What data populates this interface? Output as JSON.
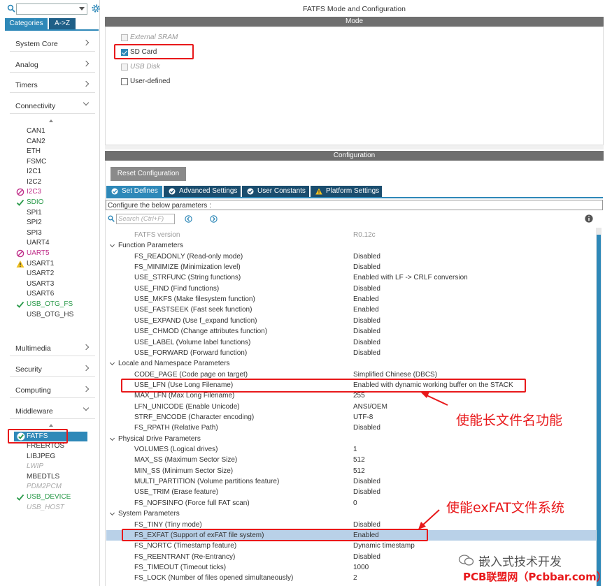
{
  "left": {
    "tabs": [
      "Categories",
      "A->Z"
    ],
    "categories": [
      "System Core",
      "Analog",
      "Timers",
      "Connectivity"
    ],
    "connectivity_items": [
      "CAN1",
      "CAN2",
      "ETH",
      "FSMC",
      "I2C1",
      "I2C2",
      "I2C3",
      "SDIO",
      "SPI1",
      "SPI2",
      "SPI3",
      "UART4",
      "UART5",
      "USART1",
      "USART2",
      "USART3",
      "USART6",
      "USB_OTG_FS",
      "USB_OTG_HS"
    ],
    "categories2": [
      "Multimedia",
      "Security",
      "Computing",
      "Middleware"
    ],
    "middleware_items": [
      "FATFS",
      "FREERTOS",
      "LIBJPEG",
      "LWIP",
      "MBEDTLS",
      "PDM2PCM",
      "USB_DEVICE",
      "USB_HOST"
    ]
  },
  "header": {
    "title": "FATFS Mode and Configuration",
    "mode_bar": "Mode",
    "config_bar": "Configuration"
  },
  "mode": {
    "options": [
      {
        "label": "External SRAM",
        "checked": false,
        "disabled": true
      },
      {
        "label": "SD Card",
        "checked": true,
        "disabled": false
      },
      {
        "label": "USB Disk",
        "checked": false,
        "disabled": true
      },
      {
        "label": "User-defined",
        "checked": false,
        "disabled": false
      }
    ]
  },
  "config": {
    "reset_label": "Reset Configuration",
    "tabs": [
      "Set Defines",
      "Advanced Settings",
      "User Constants",
      "Platform Settings"
    ],
    "description": "Configure the below parameters :",
    "search_placeholder": "Search (Ctrl+F)",
    "rows": [
      {
        "kind": "param",
        "dim": true,
        "name": "FATFS version",
        "value": "R0.12c"
      },
      {
        "kind": "group",
        "name": "Function Parameters"
      },
      {
        "kind": "param",
        "name": "FS_READONLY (Read-only mode)",
        "value": "Disabled"
      },
      {
        "kind": "param",
        "name": "FS_MINIMIZE (Minimization level)",
        "value": "Disabled"
      },
      {
        "kind": "param",
        "name": "USE_STRFUNC (String functions)",
        "value": "Enabled with LF -> CRLF conversion"
      },
      {
        "kind": "param",
        "name": "USE_FIND (Find functions)",
        "value": "Disabled"
      },
      {
        "kind": "param",
        "name": "USE_MKFS (Make filesystem function)",
        "value": "Enabled"
      },
      {
        "kind": "param",
        "name": "USE_FASTSEEK (Fast seek function)",
        "value": "Enabled"
      },
      {
        "kind": "param",
        "name": "USE_EXPAND (Use f_expand function)",
        "value": "Disabled"
      },
      {
        "kind": "param",
        "name": "USE_CHMOD (Change attributes function)",
        "value": "Disabled"
      },
      {
        "kind": "param",
        "name": "USE_LABEL (Volume label functions)",
        "value": "Disabled"
      },
      {
        "kind": "param",
        "name": "USE_FORWARD (Forward function)",
        "value": "Disabled"
      },
      {
        "kind": "group",
        "name": "Locale and Namespace Parameters"
      },
      {
        "kind": "param",
        "name": "CODE_PAGE (Code page on target)",
        "value": "Simplified Chinese (DBCS)"
      },
      {
        "kind": "param",
        "name": "USE_LFN (Use Long Filename)",
        "value": "Enabled with dynamic working buffer on the STACK"
      },
      {
        "kind": "param",
        "name": "MAX_LFN (Max Long Filename)",
        "value": "255"
      },
      {
        "kind": "param",
        "name": "LFN_UNICODE (Enable Unicode)",
        "value": "ANSI/OEM"
      },
      {
        "kind": "param",
        "name": "STRF_ENCODE (Character encoding)",
        "value": "UTF-8"
      },
      {
        "kind": "param",
        "name": "FS_RPATH (Relative Path)",
        "value": "Disabled"
      },
      {
        "kind": "group",
        "name": "Physical Drive Parameters"
      },
      {
        "kind": "param",
        "name": "VOLUMES (Logical drives)",
        "value": "1"
      },
      {
        "kind": "param",
        "name": "MAX_SS (Maximum Sector Size)",
        "value": "512"
      },
      {
        "kind": "param",
        "name": "MIN_SS (Minimum Sector Size)",
        "value": "512"
      },
      {
        "kind": "param",
        "name": "MULTI_PARTITION (Volume partitions feature)",
        "value": "Disabled"
      },
      {
        "kind": "param",
        "name": "USE_TRIM (Erase feature)",
        "value": "Disabled"
      },
      {
        "kind": "param",
        "name": "FS_NOFSINFO (Force full FAT scan)",
        "value": "0"
      },
      {
        "kind": "group",
        "name": "System Parameters"
      },
      {
        "kind": "param",
        "name": "FS_TINY (Tiny mode)",
        "value": "Disabled"
      },
      {
        "kind": "param",
        "hl": true,
        "name": "FS_EXFAT (Support of exFAT file system)",
        "value": "Enabled"
      },
      {
        "kind": "param",
        "name": "FS_NORTC (Timestamp feature)",
        "value": "Dynamic timestamp"
      },
      {
        "kind": "param",
        "name": "FS_REENTRANT (Re-Entrancy)",
        "value": "Disabled"
      },
      {
        "kind": "param",
        "name": "FS_TIMEOUT (Timeout ticks)",
        "value": "1000"
      },
      {
        "kind": "param",
        "name": "FS_LOCK (Number of files opened simultaneously)",
        "value": "2"
      }
    ]
  },
  "annotations": {
    "lfn_note": "使能长文件名功能",
    "exfat_note": "使能exFAT文件系统"
  },
  "watermark": {
    "line1": "嵌入式技术开发",
    "line2": "PCB联盟网（Pcbbar.com）"
  },
  "colors": {
    "accent": "#2e88b8",
    "annotation": "#e8191b",
    "ok": "#2a9a4a",
    "error": "#c0308a",
    "warn": "#f0c020"
  }
}
